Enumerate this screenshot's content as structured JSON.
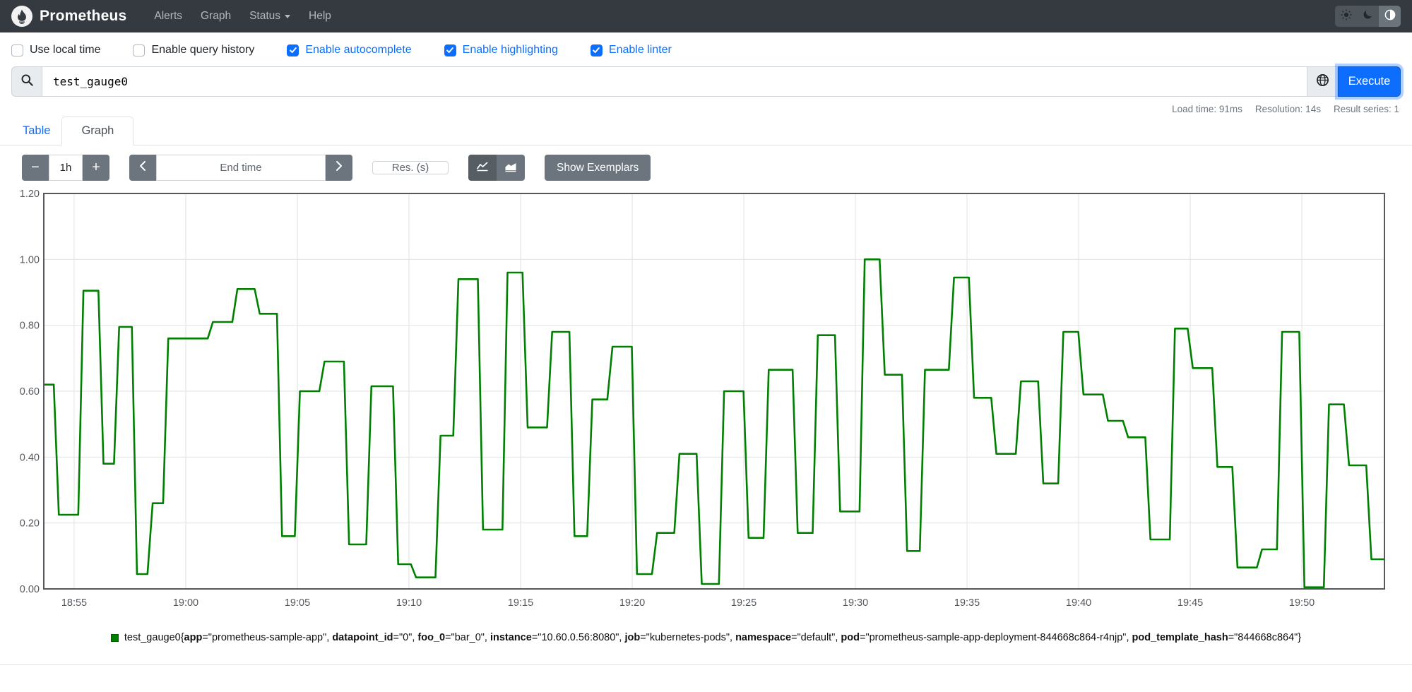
{
  "navbar": {
    "brand": "Prometheus",
    "links": [
      {
        "label": "Alerts",
        "dropdown": false
      },
      {
        "label": "Graph",
        "dropdown": false
      },
      {
        "label": "Status",
        "dropdown": true
      },
      {
        "label": "Help",
        "dropdown": false
      }
    ],
    "theme_buttons": [
      {
        "icon": "sun-icon",
        "active": false
      },
      {
        "icon": "moon-icon",
        "active": false
      },
      {
        "icon": "auto-contrast-icon",
        "active": true
      }
    ]
  },
  "options": [
    {
      "label": "Use local time",
      "checked": false
    },
    {
      "label": "Enable query history",
      "checked": false
    },
    {
      "label": "Enable autocomplete",
      "checked": true
    },
    {
      "label": "Enable highlighting",
      "checked": true
    },
    {
      "label": "Enable linter",
      "checked": true
    }
  ],
  "query": {
    "value": "test_gauge0",
    "execute_label": "Execute"
  },
  "stats": {
    "items": [
      "Load time: 91ms",
      "Resolution: 14s",
      "Result series: 1"
    ]
  },
  "tabs": [
    {
      "label": "Table",
      "active": false
    },
    {
      "label": "Graph",
      "active": true
    }
  ],
  "controls": {
    "range_minus": "−",
    "range_value": "1h",
    "range_plus": "+",
    "end_time_placeholder": "End time",
    "res_placeholder": "Res. (s)",
    "show_exemplars": "Show Exemplars"
  },
  "chart_data": {
    "type": "line",
    "style": "step-gauge",
    "series_color": "#008000",
    "x_start_min": 53.64,
    "x_end_min": 113.7,
    "x_ticks": [
      {
        "m": 55,
        "label": "18:55"
      },
      {
        "m": 60,
        "label": "19:00"
      },
      {
        "m": 65,
        "label": "19:05"
      },
      {
        "m": 70,
        "label": "19:10"
      },
      {
        "m": 75,
        "label": "19:15"
      },
      {
        "m": 80,
        "label": "19:20"
      },
      {
        "m": 85,
        "label": "19:25"
      },
      {
        "m": 90,
        "label": "19:30"
      },
      {
        "m": 95,
        "label": "19:35"
      },
      {
        "m": 100,
        "label": "19:40"
      },
      {
        "m": 105,
        "label": "19:45"
      },
      {
        "m": 110,
        "label": "19:50"
      }
    ],
    "y_ticks": [
      "0.00",
      "0.20",
      "0.40",
      "0.60",
      "0.80",
      "1.00",
      "1.20"
    ],
    "ylim": [
      0,
      1.2
    ],
    "transition_min": 0.23,
    "plateaus": [
      [
        53.64,
        0.62
      ],
      [
        54.2,
        0.225
      ],
      [
        55.3,
        0.905
      ],
      [
        56.2,
        0.38
      ],
      [
        56.9,
        0.795
      ],
      [
        57.7,
        0.045
      ],
      [
        58.4,
        0.26
      ],
      [
        59.1,
        0.76
      ],
      [
        61.1,
        0.81
      ],
      [
        62.2,
        0.91
      ],
      [
        63.2,
        0.835
      ],
      [
        64.2,
        0.16
      ],
      [
        65.0,
        0.6
      ],
      [
        66.1,
        0.69
      ],
      [
        67.2,
        0.135
      ],
      [
        68.2,
        0.615
      ],
      [
        69.4,
        0.075
      ],
      [
        70.2,
        0.035
      ],
      [
        71.3,
        0.465
      ],
      [
        72.1,
        0.94
      ],
      [
        73.2,
        0.18
      ],
      [
        74.3,
        0.96
      ],
      [
        75.2,
        0.49
      ],
      [
        76.3,
        0.78
      ],
      [
        77.3,
        0.16
      ],
      [
        78.1,
        0.575
      ],
      [
        79.0,
        0.735
      ],
      [
        80.1,
        0.045
      ],
      [
        81.0,
        0.17
      ],
      [
        82.0,
        0.41
      ],
      [
        83.0,
        0.015
      ],
      [
        84.0,
        0.6
      ],
      [
        85.1,
        0.155
      ],
      [
        86.0,
        0.665
      ],
      [
        87.3,
        0.17
      ],
      [
        88.2,
        0.77
      ],
      [
        89.2,
        0.235
      ],
      [
        90.3,
        1.0
      ],
      [
        91.2,
        0.65
      ],
      [
        92.2,
        0.115
      ],
      [
        93.0,
        0.665
      ],
      [
        94.3,
        0.945
      ],
      [
        95.2,
        0.58
      ],
      [
        96.2,
        0.41
      ],
      [
        97.3,
        0.63
      ],
      [
        98.3,
        0.32
      ],
      [
        99.2,
        0.78
      ],
      [
        100.1,
        0.59
      ],
      [
        101.2,
        0.51
      ],
      [
        102.1,
        0.46
      ],
      [
        103.1,
        0.15
      ],
      [
        104.2,
        0.79
      ],
      [
        105.0,
        0.67
      ],
      [
        106.1,
        0.37
      ],
      [
        107.0,
        0.065
      ],
      [
        108.1,
        0.12
      ],
      [
        109.0,
        0.78
      ],
      [
        110.0,
        0.005
      ],
      [
        111.1,
        0.56
      ],
      [
        112.0,
        0.375
      ],
      [
        113.0,
        0.09
      ]
    ]
  },
  "legend": {
    "metric": "test_gauge0",
    "swatch_color": "#008000",
    "labels": [
      [
        "app",
        "prometheus-sample-app"
      ],
      [
        "datapoint_id",
        "0"
      ],
      [
        "foo_0",
        "bar_0"
      ],
      [
        "instance",
        "10.60.0.56:8080"
      ],
      [
        "job",
        "kubernetes-pods"
      ],
      [
        "namespace",
        "default"
      ],
      [
        "pod",
        "prometheus-sample-app-deployment-844668c864-r4njp"
      ],
      [
        "pod_template_hash",
        "844668c864"
      ]
    ]
  }
}
